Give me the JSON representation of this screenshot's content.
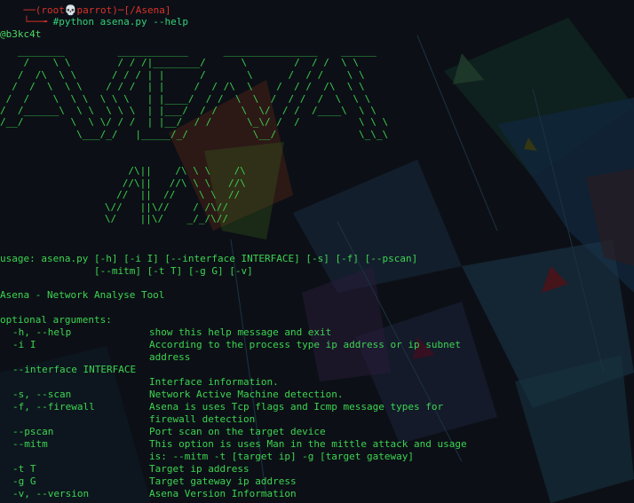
{
  "prompt": {
    "hidden_line": "──(root💀parrot)─[/Asena]",
    "command": "#python asena.py --help"
  },
  "author": "@b3kc4t",
  "banner_big": "   ________         ____________      ________________    ______     \n    /    \\ \\        / / /|________/      \\        /  / /  \\ \\   \n   /  /\\  \\ \\      / / / | |      /       \\      /  / /    \\ \\  \n  /  /  \\  \\ \\    / / /  | |     /  / /\\  \\    /  / /  /\\  \\ \\ \n /  /    \\  \\ \\  \\ \\ \\   | |____/  / /  \\  \\  /  / /  /  \\  \\ \\\n/  /______\\  \\ \\  \\ \\ \\  | |___/  / /    \\  \\/  / /  /____\\  \\ \\\n/__/        \\  \\ \\/ / /  | |__/  / /      \\_\\/ /  /          \\ \\ \\\n             \\___/_/   |_____/_/           \\__/              \\_\\_\\",
  "banner_small": "       /\\||    /\\ \\ \\    /\\\n      //\\||   //\\ \\ \\   //\\\n     //  ||  //    \\ \\  //\n   \\//   ||\\//    / /\\//\n   \\/    ||\\/    _/_/\\//",
  "usage_line1": "usage: asena.py [-h] [-i I] [--interface INTERFACE] [-s] [-f] [--pscan]",
  "usage_line2": "                [--mitm] [-t T] [-g G] [-v]",
  "tool_title": "Asena - Network Analyse Tool",
  "optional_header": "optional arguments:",
  "options": [
    {
      "flag": "-h, --help",
      "desc": [
        "show this help message and exit"
      ]
    },
    {
      "flag": "-i I",
      "desc": [
        "According to the process type ip address or ip subnet",
        "address"
      ]
    },
    {
      "flag": "--interface INTERFACE",
      "desc": [
        "",
        "Interface information."
      ]
    },
    {
      "flag": "-s, --scan",
      "desc": [
        "Network Active Machine detection."
      ]
    },
    {
      "flag": "-f, --firewall",
      "desc": [
        "Asena is uses Tcp flags and Icmp message types for",
        "firewall detection"
      ]
    },
    {
      "flag": "--pscan",
      "desc": [
        "Port scan on the target device"
      ]
    },
    {
      "flag": "--mitm",
      "desc": [
        "This option is uses Man in the mittle attack and usage",
        "is: --mitm -t [target ip] -g [target gateway]"
      ]
    },
    {
      "flag": "-t T",
      "desc": [
        "Target ip address"
      ]
    },
    {
      "flag": "-g G",
      "desc": [
        "Target gateway ip address"
      ]
    },
    {
      "flag": "-v, --version",
      "desc": [
        "Asena Version Information"
      ]
    }
  ],
  "colors": {
    "text": "#3dd451",
    "prompt": "#d9322c",
    "background": "#0b0e12"
  }
}
